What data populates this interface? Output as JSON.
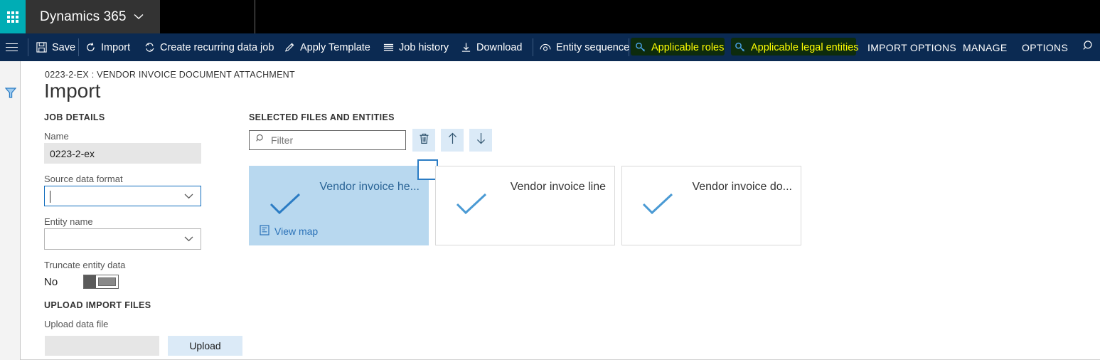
{
  "header": {
    "waffle_icon": "waffle-grid-icon",
    "app_name": "Dynamics 365",
    "app_chevron_icon": "chevron-down-icon"
  },
  "commandbar": {
    "menu_icon": "hamburger-menu-icon",
    "search_icon": "search-icon",
    "items": [
      {
        "label": "Save",
        "icon": "save-disk-icon",
        "highlighted": false
      },
      {
        "label": "Import",
        "icon": "refresh-circle-icon",
        "highlighted": false
      },
      {
        "label": "Create recurring data job",
        "icon": "recurring-cycle-icon",
        "highlighted": false
      },
      {
        "label": "Apply Template",
        "icon": "pencil-edit-icon",
        "highlighted": false
      },
      {
        "label": "Job history",
        "icon": "list-lines-icon",
        "highlighted": false
      },
      {
        "label": "Download",
        "icon": "download-arrow-icon",
        "highlighted": false
      },
      {
        "label": "Entity sequence",
        "icon": "eye-sequence-icon",
        "highlighted": false
      },
      {
        "label": "Applicable roles",
        "icon": "key-icon",
        "highlighted": true
      },
      {
        "label": "Applicable legal entities",
        "icon": "key-icon",
        "highlighted": true
      }
    ],
    "menus": [
      "IMPORT OPTIONS",
      "MANAGE",
      "OPTIONS"
    ],
    "highlight_bg": "#0d2b0d",
    "highlight_text": "#ffff00"
  },
  "rail": {
    "filter_icon": "funnel-filter-icon"
  },
  "page": {
    "breadcrumb": "0223-2-EX : VENDOR INVOICE DOCUMENT ATTACHMENT",
    "title": "Import"
  },
  "job_details": {
    "section_title": "JOB DETAILS",
    "name_label": "Name",
    "name_value": "0223-2-ex",
    "source_format_label": "Source data format",
    "source_format_value": "",
    "entity_name_label": "Entity name",
    "entity_name_value": "",
    "truncate_label": "Truncate entity data",
    "truncate_value": "No",
    "dropdown_icon": "chevron-down-icon"
  },
  "upload": {
    "section_title": "UPLOAD IMPORT FILES",
    "file_label": "Upload data file",
    "file_value": "",
    "button_label": "Upload"
  },
  "selected_files": {
    "section_title": "SELECTED FILES AND ENTITIES",
    "filter_placeholder": "Filter",
    "filter_value": "",
    "search_icon": "search-icon",
    "actions": [
      {
        "name": "delete-button",
        "icon": "trash-icon"
      },
      {
        "name": "move-up-button",
        "icon": "arrow-up-icon"
      },
      {
        "name": "move-down-button",
        "icon": "arrow-down-icon"
      }
    ],
    "tiles": [
      {
        "title": "Vendor invoice he...",
        "selected": true,
        "check_icon": "checkmark-icon",
        "view_map_label": "View map",
        "view_map_icon": "map-document-icon",
        "has_checkbox": true
      },
      {
        "title": "Vendor invoice line",
        "selected": false,
        "check_icon": "checkmark-icon",
        "view_map_label": "",
        "view_map_icon": "",
        "has_checkbox": false
      },
      {
        "title": "Vendor invoice do...",
        "selected": false,
        "check_icon": "checkmark-icon",
        "view_map_label": "",
        "view_map_icon": "",
        "has_checkbox": false
      }
    ]
  },
  "colors": {
    "teal": "#00adb5",
    "navy": "#0b2a52",
    "accent_blue": "#2b7cc4",
    "tile_selected": "#b8d8ef",
    "button_blue": "#dbeaf7"
  }
}
